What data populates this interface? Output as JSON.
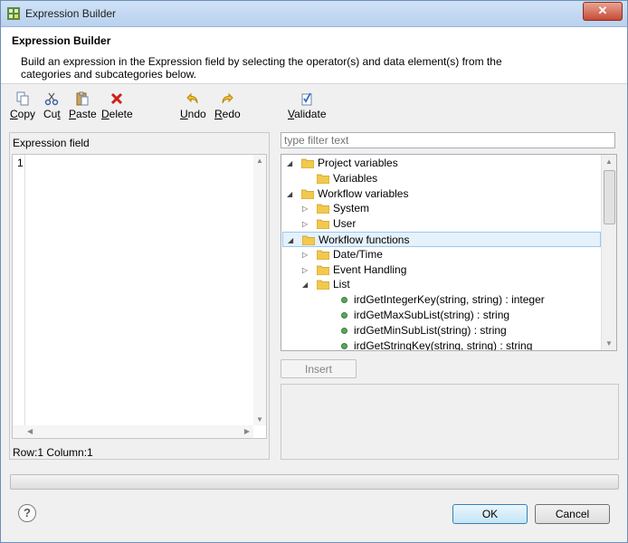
{
  "window": {
    "title": "Expression Builder"
  },
  "header": {
    "title": "Expression Builder",
    "description": "Build an expression in the Expression field by selecting the operator(s) and data element(s) from the categories and subcategories below."
  },
  "toolbar": {
    "copy": {
      "mnemonic": "C",
      "rest": "opy"
    },
    "cut": {
      "pre": "Cu",
      "mnemonic": "t",
      "rest": ""
    },
    "paste": {
      "mnemonic": "P",
      "rest": "aste"
    },
    "delete": {
      "mnemonic": "D",
      "rest": "elete"
    },
    "undo": {
      "mnemonic": "U",
      "rest": "ndo"
    },
    "redo": {
      "mnemonic": "R",
      "rest": "edo"
    },
    "validate": {
      "mnemonic": "V",
      "rest": "alidate"
    }
  },
  "expression": {
    "label": "Expression field",
    "line_number": "1",
    "status": "Row:1 Column:1"
  },
  "filter": {
    "placeholder": "type filter text"
  },
  "tree": {
    "items": [
      {
        "label": "Project variables",
        "kind": "folder",
        "level": 0,
        "state": "expanded"
      },
      {
        "label": "Variables",
        "kind": "folder",
        "level": 1,
        "state": "leaf"
      },
      {
        "label": "Workflow variables",
        "kind": "folder",
        "level": 0,
        "state": "expanded"
      },
      {
        "label": "System",
        "kind": "folder",
        "level": 1,
        "state": "collapsed"
      },
      {
        "label": "User",
        "kind": "folder",
        "level": 1,
        "state": "collapsed"
      },
      {
        "label": "Workflow functions",
        "kind": "folder",
        "level": 0,
        "state": "expanded",
        "selected": true
      },
      {
        "label": "Date/Time",
        "kind": "folder",
        "level": 1,
        "state": "collapsed"
      },
      {
        "label": "Event Handling",
        "kind": "folder",
        "level": 1,
        "state": "collapsed"
      },
      {
        "label": "List",
        "kind": "folder",
        "level": 1,
        "state": "expanded"
      },
      {
        "label": "irdGetIntegerKey(string, string) : integer",
        "kind": "function",
        "level": 2
      },
      {
        "label": "irdGetMaxSubList(string) : string",
        "kind": "function",
        "level": 2
      },
      {
        "label": "irdGetMinSubList(string) : string",
        "kind": "function",
        "level": 2
      },
      {
        "label": "irdGetStringKey(string, string) : string",
        "kind": "function",
        "level": 2
      }
    ]
  },
  "buttons": {
    "insert": "Insert",
    "ok": "OK",
    "cancel": "Cancel"
  },
  "colors": {
    "accent": "#3c7fb1",
    "folder": "#f2c94c",
    "function_dot": "#58a858",
    "selection": "#e5f1fb"
  }
}
